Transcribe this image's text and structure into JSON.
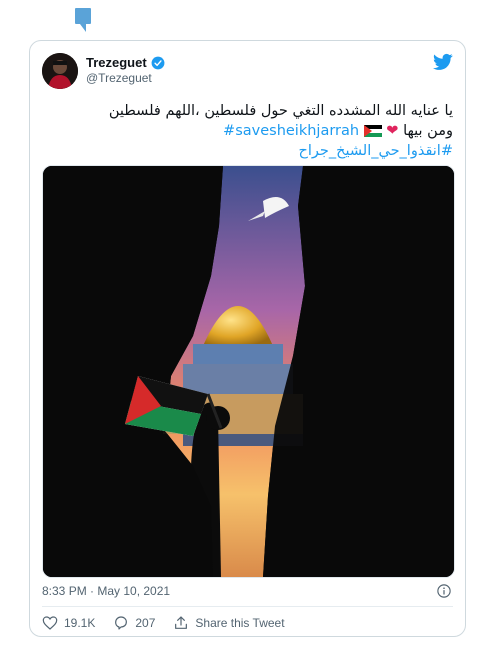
{
  "tweet": {
    "author": {
      "name": "Trezeguet",
      "handle": "@Trezeguet",
      "verified": true
    },
    "text": {
      "line1": "يا عنايه الله المشدده التغي حول فلسطين ،اللهم فلسطين",
      "line2_text": "ومن بيها",
      "line2_hashtag": "#savesheikhjarrah",
      "line3_hashtag": "#انقذوا_حي_الشيخ_جراح"
    },
    "timestamp": "8:33 PM · May 10, 2021",
    "actions": {
      "likes": "19.1K",
      "replies": "207",
      "share": "Share this Tweet"
    }
  },
  "colors": {
    "accent": "#1d9bf0",
    "heart": "#e0245e",
    "muted": "#536471",
    "border": "#cfd9de"
  },
  "icons": [
    "notification-bubble-icon",
    "verified-icon",
    "twitter-bird-icon",
    "info-icon",
    "heart-icon",
    "reply-icon",
    "share-icon"
  ]
}
